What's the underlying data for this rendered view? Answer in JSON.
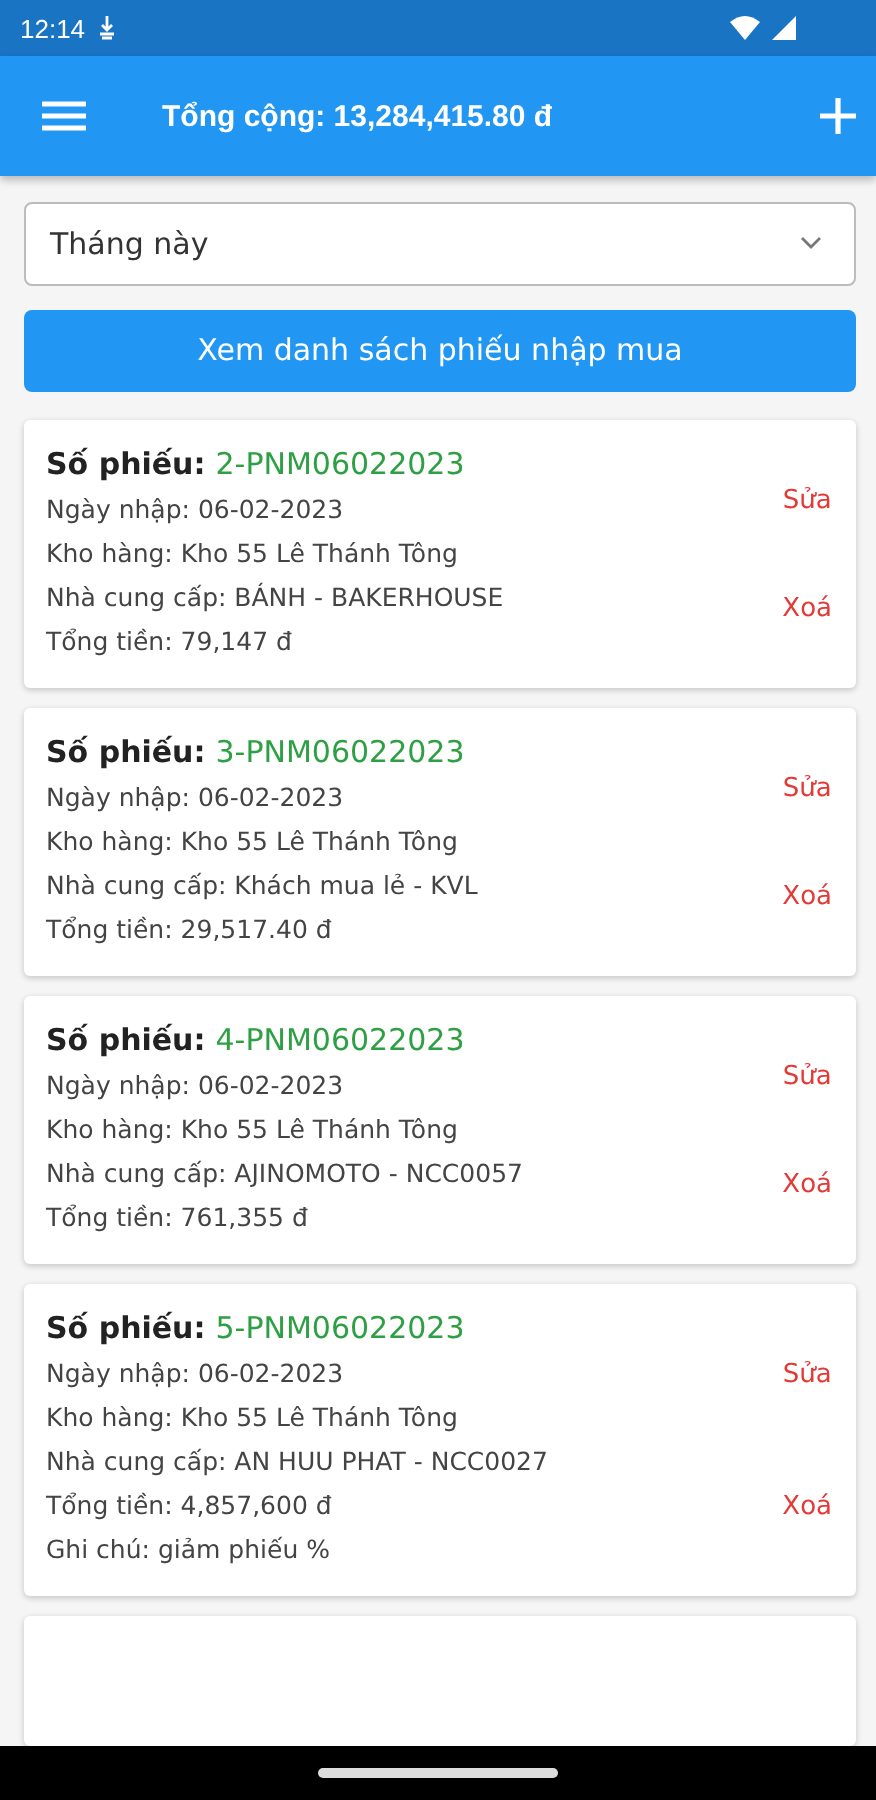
{
  "status_bar": {
    "time": "12:14"
  },
  "app_bar": {
    "title": "Tổng cộng: 13,284,415.80 đ"
  },
  "filter": {
    "value": "Tháng này"
  },
  "list_button": {
    "label": "Xem danh sách phiếu nhập mua"
  },
  "records": [
    {
      "number_label": "Số phiếu:",
      "number": "2-PNM06022023",
      "lines": [
        "Ngày nhập: 06-02-2023",
        "Kho hàng: Kho 55 Lê Thánh Tông",
        "Nhà cung cấp: BÁNH - BAKERHOUSE",
        "Tổng tiền: 79,147 đ"
      ],
      "actions": [
        "Sửa",
        "Xoá"
      ]
    },
    {
      "number_label": "Số phiếu:",
      "number": "3-PNM06022023",
      "lines": [
        "Ngày nhập: 06-02-2023",
        "Kho hàng: Kho 55 Lê Thánh Tông",
        "Nhà cung cấp: Khách mua lẻ - KVL",
        "Tổng tiền: 29,517.40 đ"
      ],
      "actions": [
        "Sửa",
        "Xoá"
      ]
    },
    {
      "number_label": "Số phiếu:",
      "number": "4-PNM06022023",
      "lines": [
        "Ngày nhập: 06-02-2023",
        "Kho hàng: Kho 55 Lê Thánh Tông",
        "Nhà cung cấp: AJINOMOTO - NCC0057",
        "Tổng tiền: 761,355 đ"
      ],
      "actions": [
        "Sửa",
        "Xoá"
      ]
    },
    {
      "number_label": "Số phiếu:",
      "number": "5-PNM06022023",
      "lines": [
        "Ngày nhập: 06-02-2023",
        "Kho hàng: Kho 55 Lê Thánh Tông",
        "Nhà cung cấp: AN HUU PHAT - NCC0027",
        "Tổng tiền: 4,857,600 đ",
        "Ghi chú: giảm phiếu %"
      ],
      "actions": [
        "Sửa",
        "Xoá"
      ]
    }
  ]
}
